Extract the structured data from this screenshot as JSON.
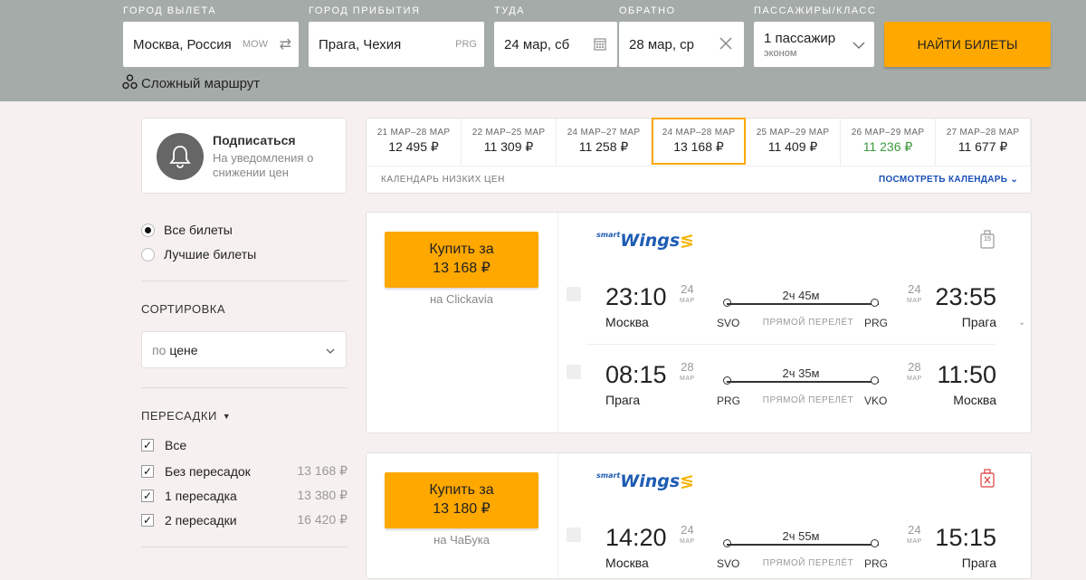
{
  "search": {
    "labels": {
      "from": "ГОРОД ВЫЛЕТА",
      "to": "ГОРОД ПРИБЫТИЯ",
      "depart": "ТУДА",
      "return": "ОБРАТНО",
      "pax": "ПАССАЖИРЫ/КЛАСС"
    },
    "from_value": "Москва, Россия",
    "from_code": "MOW",
    "to_value": "Прага, Чехия",
    "to_code": "PRG",
    "depart_value": "24 мар, сб",
    "return_value": "28 мар, ср",
    "pax_value": "1 пассажир",
    "class_value": "эконом",
    "button_label": "НАЙТИ БИЛЕТЫ",
    "complex_route": "Сложный маршрут"
  },
  "subscribe": {
    "title": "Подписаться",
    "text_line1": "На уведомления о",
    "text_line2": "снижении цен"
  },
  "calendar": {
    "cells": [
      {
        "range": "21 МАР–28 МАР",
        "price": "12 495 ₽",
        "cheap": false,
        "selected": false
      },
      {
        "range": "22 МАР–25 МАР",
        "price": "11 309 ₽",
        "cheap": false,
        "selected": false
      },
      {
        "range": "24 МАР–27 МАР",
        "price": "11 258 ₽",
        "cheap": false,
        "selected": false
      },
      {
        "range": "24 МАР–28 МАР",
        "price": "13 168 ₽",
        "cheap": false,
        "selected": true
      },
      {
        "range": "25 МАР–29 МАР",
        "price": "11 409 ₽",
        "cheap": false,
        "selected": false
      },
      {
        "range": "26 МАР–29 МАР",
        "price": "11 236 ₽",
        "cheap": true,
        "selected": false
      },
      {
        "range": "27 МАР–28 МАР",
        "price": "11 677 ₽",
        "cheap": false,
        "selected": false
      }
    ],
    "footer_label": "КАЛЕНДАРЬ НИЗКИХ ЦЕН",
    "view_link": "ПОСМОТРЕТЬ КАЛЕНДАРЬ"
  },
  "filters": {
    "all_tickets": "Все билеты",
    "best_tickets": "Лучшие билеты",
    "sort_title": "СОРТИРОВКА",
    "sort_prefix": "по",
    "sort_value": "цене",
    "stops_title": "ПЕРЕСАДКИ",
    "stops": [
      {
        "label": "Все",
        "price": ""
      },
      {
        "label": "Без пересадок",
        "price": "13 168 ₽"
      },
      {
        "label": "1 пересадка",
        "price": "13 380 ₽"
      },
      {
        "label": "2 пересадки",
        "price": "16 420 ₽"
      }
    ]
  },
  "results": [
    {
      "buy_line1": "Купить за",
      "buy_price": "13 168 ₽",
      "agent": "на Clickavia",
      "airline_small": "smart",
      "airline_name": "Wings",
      "baggage_badge": "15",
      "segments": [
        {
          "dep_time": "23:10",
          "dep_day": "24",
          "dep_mon": "МАР",
          "dep_city": "Москва",
          "dep_ap": "SVO",
          "duration": "2ч 45м",
          "direct": "ПРЯМОЙ ПЕРЕЛЁТ",
          "arr_ap": "PRG",
          "arr_day": "24",
          "arr_mon": "МАР",
          "arr_time": "23:55",
          "arr_city": "Прага"
        },
        {
          "dep_time": "08:15",
          "dep_day": "28",
          "dep_mon": "МАР",
          "dep_city": "Прага",
          "dep_ap": "PRG",
          "duration": "2ч 35м",
          "direct": "ПРЯМОЙ ПЕРЕЛЁТ",
          "arr_ap": "VKO",
          "arr_day": "28",
          "arr_mon": "МАР",
          "arr_time": "11:50",
          "arr_city": "Москва"
        }
      ]
    },
    {
      "buy_line1": "Купить за",
      "buy_price": "13 180 ₽",
      "agent": "на ЧаБука",
      "airline_small": "smart",
      "airline_name": "Wings",
      "segments": [
        {
          "dep_time": "14:20",
          "dep_day": "24",
          "dep_mon": "МАР",
          "dep_city": "Москва",
          "dep_ap": "SVO",
          "duration": "2ч 55м",
          "direct": "ПРЯМОЙ ПЕРЕЛЁТ",
          "arr_ap": "PRG",
          "arr_day": "24",
          "arr_mon": "МАР",
          "arr_time": "15:15",
          "arr_city": "Прага"
        }
      ]
    }
  ],
  "colors": {
    "accent": "#ffa800",
    "header": "#a5aba8",
    "link": "#1a4fb5",
    "cheap": "#3a9a3a",
    "baggage_none": "#e04040"
  }
}
